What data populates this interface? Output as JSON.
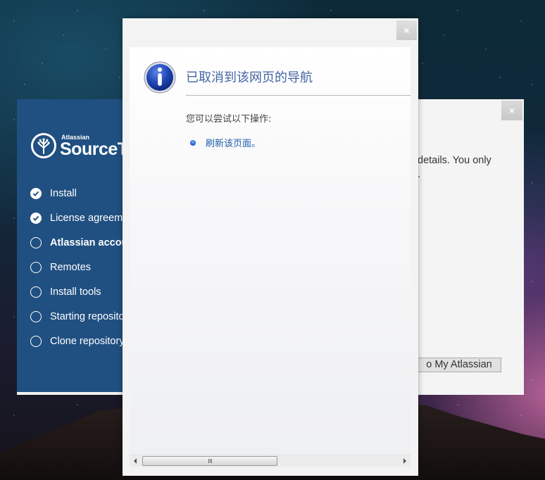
{
  "setup_window": {
    "logo": {
      "brand_small": "Atlassian",
      "brand_big": "SourceTree",
      "icon": "sourcetree-tree-icon"
    },
    "steps": [
      {
        "label": "Install",
        "status": "done",
        "icon": "check-circle-icon"
      },
      {
        "label": "License agreement",
        "status": "done",
        "icon": "check-circle-icon"
      },
      {
        "label": "Atlassian account",
        "status": "active",
        "icon": "empty-circle-icon"
      },
      {
        "label": "Remotes",
        "status": "todo",
        "icon": "empty-circle-icon"
      },
      {
        "label": "Install tools",
        "status": "todo",
        "icon": "empty-circle-icon"
      },
      {
        "label": "Starting repository",
        "status": "todo",
        "icon": "empty-circle-icon"
      },
      {
        "label": "Clone repository",
        "status": "todo",
        "icon": "empty-circle-icon"
      }
    ],
    "body_text_line1": "details. You only",
    "body_text_line2": ".",
    "button_label": "o My Atlassian",
    "close_label": "×",
    "colors": {
      "sidebar": "#205081",
      "panel": "#f4f4f4"
    }
  },
  "dialog": {
    "close_label": "×",
    "heading": "已取消到该网页的导航",
    "hint": "您可以尝试以下操作:",
    "suggestions": [
      {
        "label": "刷新该页面。"
      }
    ],
    "info_icon": "info-icon",
    "colors": {
      "heading": "#4465a3",
      "link": "#1d5ea8"
    },
    "scrollbar": {
      "grip": "|||"
    }
  }
}
